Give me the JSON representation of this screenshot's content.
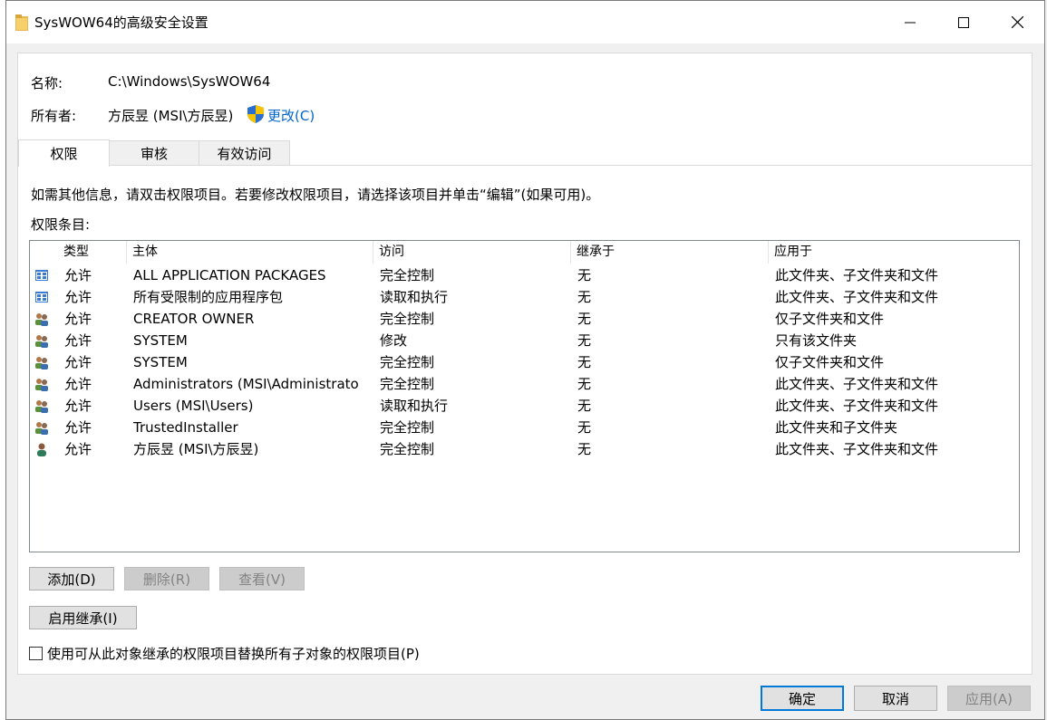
{
  "window": {
    "title": "SysWOW64的高级安全设置"
  },
  "info": {
    "name_label": "名称:",
    "name_value": "C:\\Windows\\SysWOW64",
    "owner_label": "所有者:",
    "owner_value": "方辰昱 (MSI\\方辰昱)",
    "change_link": "更改(C)"
  },
  "tabs": [
    {
      "label": "权限",
      "active": true
    },
    {
      "label": "审核",
      "active": false
    },
    {
      "label": "有效访问",
      "active": false
    }
  ],
  "instructions": "如需其他信息，请双击权限项目。若要修改权限项目，请选择该项目并单击“编辑”(如果可用)。",
  "entries_label": "权限条目:",
  "table": {
    "columns": [
      "类型",
      "主体",
      "访问",
      "继承于",
      "应用于"
    ],
    "rows": [
      {
        "icon": "package-icon",
        "type": "允许",
        "principal": "ALL APPLICATION PACKAGES",
        "access": "完全控制",
        "inherited": "无",
        "applies": "此文件夹、子文件夹和文件"
      },
      {
        "icon": "package-icon",
        "type": "允许",
        "principal": "所有受限制的应用程序包",
        "access": "读取和执行",
        "inherited": "无",
        "applies": "此文件夹、子文件夹和文件"
      },
      {
        "icon": "group-icon",
        "type": "允许",
        "principal": "CREATOR OWNER",
        "access": "完全控制",
        "inherited": "无",
        "applies": "仅子文件夹和文件"
      },
      {
        "icon": "group-icon",
        "type": "允许",
        "principal": "SYSTEM",
        "access": "修改",
        "inherited": "无",
        "applies": "只有该文件夹"
      },
      {
        "icon": "group-icon",
        "type": "允许",
        "principal": "SYSTEM",
        "access": "完全控制",
        "inherited": "无",
        "applies": "仅子文件夹和文件"
      },
      {
        "icon": "group-icon",
        "type": "允许",
        "principal": "Administrators (MSI\\Administrato",
        "access": "完全控制",
        "inherited": "无",
        "applies": "此文件夹、子文件夹和文件"
      },
      {
        "icon": "group-icon",
        "type": "允许",
        "principal": "Users (MSI\\Users)",
        "access": "读取和执行",
        "inherited": "无",
        "applies": "此文件夹、子文件夹和文件"
      },
      {
        "icon": "group-icon",
        "type": "允许",
        "principal": "TrustedInstaller",
        "access": "完全控制",
        "inherited": "无",
        "applies": "此文件夹和子文件夹"
      },
      {
        "icon": "user-icon",
        "type": "允许",
        "principal": "方辰昱 (MSI\\方辰昱)",
        "access": "完全控制",
        "inherited": "无",
        "applies": "此文件夹、子文件夹和文件"
      }
    ]
  },
  "buttons": {
    "add": "添加(D)",
    "remove": "删除(R)",
    "view": "查看(V)",
    "enable_inheritance": "启用继承(I)",
    "ok": "确定",
    "cancel": "取消",
    "apply": "应用(A)"
  },
  "replace_checkbox_label": "使用可从此对象继承的权限项目替换所有子对象的权限项目(P)"
}
